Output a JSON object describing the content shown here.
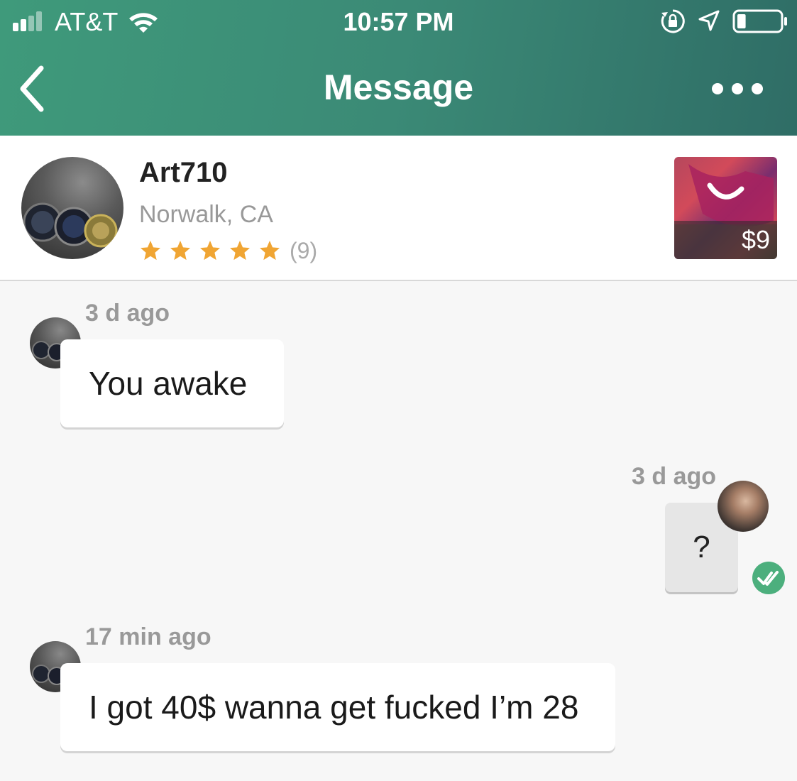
{
  "status_bar": {
    "carrier": "AT&T",
    "time": "10:57 PM",
    "signal_bars": 2,
    "battery_level": 0.2,
    "icons": [
      "signal-icon",
      "wifi-icon",
      "rotation-lock-icon",
      "location-arrow-icon",
      "battery-icon"
    ]
  },
  "nav": {
    "title": "Message",
    "back_icon": "chevron-left-icon",
    "more_icon": "more-dots-icon"
  },
  "listing": {
    "seller_name": "Art710",
    "seller_location": "Norwalk, CA",
    "rating_stars": 5,
    "review_count": "(9)",
    "price": "$9",
    "star_color": "#f0a533"
  },
  "messages": [
    {
      "direction": "incoming",
      "timestamp": "3 d ago",
      "text": "You awake"
    },
    {
      "direction": "outgoing",
      "timestamp": "3 d ago",
      "text": "?",
      "read": true
    },
    {
      "direction": "incoming",
      "timestamp": "17 min ago",
      "text": "I got 40$ wanna get fucked I’m 28"
    }
  ],
  "colors": {
    "header_start": "#3f9a7b",
    "header_end": "#2f6d66",
    "read_check": "#4caf7d"
  }
}
